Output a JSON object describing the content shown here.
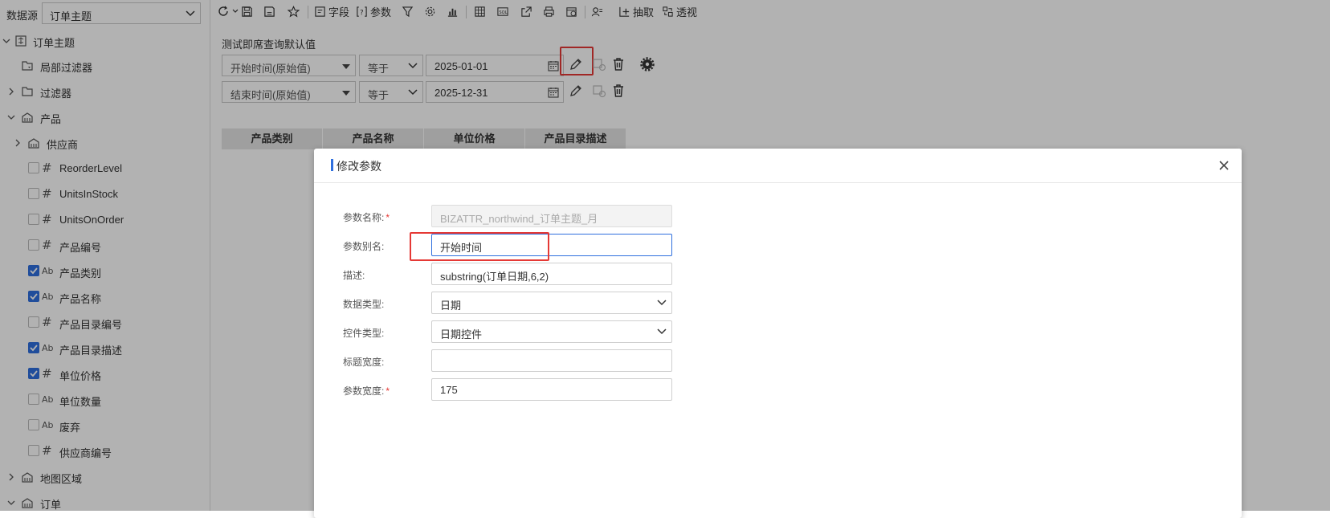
{
  "sidebar": {
    "datasource_label": "数据源",
    "datasource_value": "订单主题",
    "items": [
      {
        "label": "订单主题"
      },
      {
        "label": "局部过滤器"
      },
      {
        "label": "过滤器"
      },
      {
        "label": "产品"
      },
      {
        "label": "供应商"
      },
      {
        "label": "ReorderLevel",
        "type": "#",
        "checked": false
      },
      {
        "label": "UnitsInStock",
        "type": "#",
        "checked": false
      },
      {
        "label": "UnitsOnOrder",
        "type": "#",
        "checked": false
      },
      {
        "label": "产品编号",
        "type": "#",
        "checked": false
      },
      {
        "label": "产品类别",
        "type": "Ab",
        "checked": true
      },
      {
        "label": "产品名称",
        "type": "Ab",
        "checked": true
      },
      {
        "label": "产品目录编号",
        "type": "#",
        "checked": false
      },
      {
        "label": "产品目录描述",
        "type": "Ab",
        "checked": true
      },
      {
        "label": "单位价格",
        "type": "#",
        "checked": true
      },
      {
        "label": "单位数量",
        "type": "Ab",
        "checked": false
      },
      {
        "label": "废弃",
        "type": "Ab",
        "checked": false
      },
      {
        "label": "供应商编号",
        "type": "#",
        "checked": false
      },
      {
        "label": "地图区域"
      },
      {
        "label": "订单"
      }
    ]
  },
  "toolbar": {
    "field_label": "字段",
    "param_label": "参数",
    "extract_label": "抽取",
    "pivot_label": "透视"
  },
  "main": {
    "param_section_title": "测试即席查询默认值",
    "filters": [
      {
        "field": "开始时间(原始值)",
        "operator": "等于",
        "value": "2025-01-01"
      },
      {
        "field": "结束时间(原始值)",
        "operator": "等于",
        "value": "2025-12-31"
      }
    ],
    "table_headers": [
      "产品类别",
      "产品名称",
      "单位价格",
      "产品目录描述"
    ]
  },
  "dialog": {
    "title": "修改参数",
    "fields": [
      {
        "label": "参数名称:",
        "required": true,
        "value": "BIZATTR_northwind_订单主题_月"
      },
      {
        "label": "参数别名:",
        "required": false,
        "value": "开始时间"
      },
      {
        "label": "描述:",
        "required": false,
        "value": "substring(订单日期,6,2)"
      },
      {
        "label": "数据类型:",
        "required": false,
        "value": "日期"
      },
      {
        "label": "控件类型:",
        "required": false,
        "value": "日期控件"
      },
      {
        "label": "标题宽度:",
        "required": false,
        "value": ""
      },
      {
        "label": "参数宽度:",
        "required": true,
        "value": "175"
      }
    ],
    "required_mark": "*"
  },
  "colors": {
    "accent": "#2f6fde",
    "highlight": "#e53935",
    "required": "#e53935"
  }
}
